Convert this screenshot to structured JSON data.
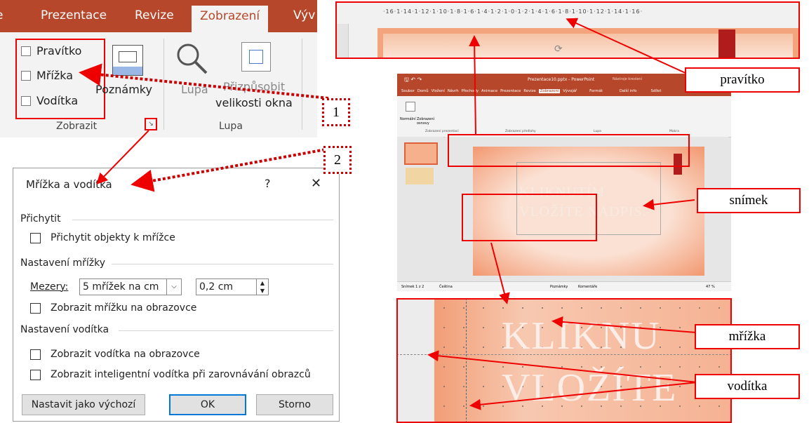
{
  "ribbon": {
    "tabs": [
      "Prezentace",
      "Revize",
      "Zobrazení",
      "Výv"
    ],
    "checkboxes": [
      "Pravítko",
      "Mřížka",
      "Vodítka"
    ],
    "poznamky": "Poznámky",
    "lupa": "Lupa",
    "fit_line1": "Přizpůsobit",
    "fit_line2": "velikosti okna",
    "group_zobrazit": "Zobrazit",
    "group_lupa": "Lupa"
  },
  "dialog": {
    "title": "Mřížka a vodítka",
    "help": "?",
    "close": "✕",
    "section_snap": "Přichytit",
    "snap_checkbox": "Přichytit objekty k mřížce",
    "section_grid": "Nastavení mřížky",
    "spacing_label": "Mezery:",
    "spacing_value": "5 mřížek na cm",
    "spacing_cm": "0,2 cm",
    "grid_checkbox": "Zobrazit mřížku na obrazovce",
    "section_guides": "Nastavení vodítka",
    "guides_checkbox": "Zobrazit vodítka na obrazovce",
    "smart_checkbox": "Zobrazit inteligentní vodítka při zarovnávání obrazců",
    "btn_default": "Nastavit jako výchozí",
    "btn_ok": "OK",
    "btn_cancel": "Storno"
  },
  "annotations": {
    "num1": "1",
    "num2": "2",
    "ruler": "pravítko",
    "slide": "snímek",
    "grid": "mřížka",
    "guides": "vodítka"
  },
  "ruler_text": "·16·1·14·1·12·1·10·1·8·1·6·1·4·1·2·1·0·1·2·1·4·1·6·1·8·1·10·1·12·1·14·1·16·",
  "ppt": {
    "title": "Prezentace10.pptx - PowerPoint",
    "tools": "Nástroje kreslení",
    "tabs": [
      "Soubor",
      "Domů",
      "Vložení",
      "Návrh",
      "Přechody",
      "Animace",
      "Prezentace",
      "Revize",
      "Zobrazení",
      "Vývojář",
      "Formát"
    ],
    "search": "Další info",
    "share": "Sdílet",
    "normal": "Normální",
    "outline": "Zobrazení osnovy",
    "group_views": "Zobrazení prezentací",
    "group_master": "Zobrazení předlohy",
    "group_zoom": "Lupa",
    "group_macro": "Makra",
    "slide_text1": "KLIKNUTÍM",
    "slide_text2": "VLOŽÍTE NADPIS.",
    "status_slide": "Snímek 1 z 2",
    "status_lang": "Čeština",
    "status_notes": "Poznámky",
    "status_comments": "Komentáře",
    "status_zoom": "47 %"
  },
  "zoom_text1": "KLIKNU",
  "zoom_text2": "VLOŽÍTE"
}
